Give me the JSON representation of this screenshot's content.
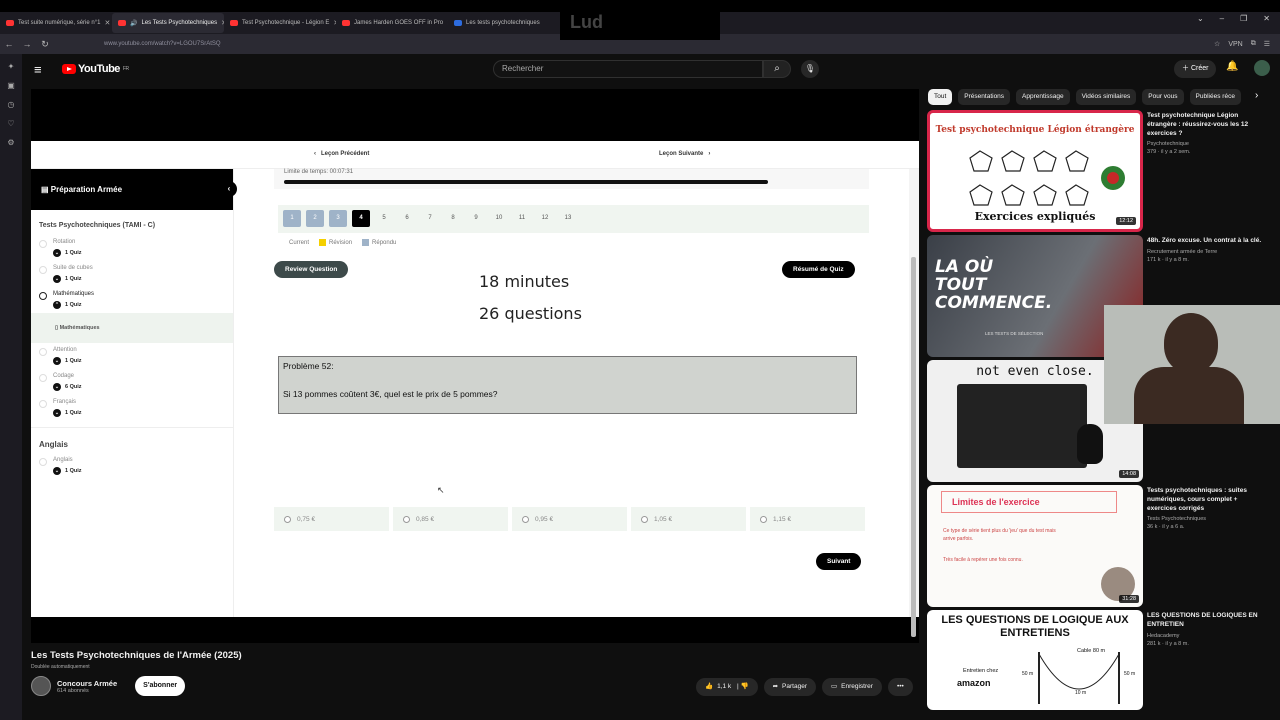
{
  "overlay_label": "Lud",
  "browser": {
    "tabs": [
      {
        "label": "Test suite numérique, série n°1",
        "color": "#ff3333"
      },
      {
        "label": "Les Tests Psychotechniques",
        "color": "#ff3333"
      },
      {
        "label": "Test Psychotechnique - Légion E",
        "color": "#ff3333"
      },
      {
        "label": "James Harden GOES OFF in Pro",
        "color": "#ff3333"
      },
      {
        "label": "Les tests psychotechniques",
        "color": "#2d6cdf"
      }
    ],
    "url": "www.youtube.com/watch?v=LGOU7SrAtSQ",
    "vpn_label": "VPN"
  },
  "youtube": {
    "logo": "YouTube",
    "logo_region": "FR",
    "search_placeholder": "Rechercher",
    "create_label": "Créer"
  },
  "course": {
    "prev_lesson": "Leçon Précédent",
    "next_lesson": "Leçon Suivante",
    "sidebar_title": "Préparation Armée",
    "section_title": "Tests Psychotechniques (TAMI - C)",
    "items": [
      {
        "name": "Rotation",
        "quiz": "1 Quiz"
      },
      {
        "name": "Suite de cubes",
        "quiz": "1 Quiz"
      },
      {
        "name": "Mathématiques",
        "quiz": "1 Quiz",
        "sub": "Mathématiques"
      },
      {
        "name": "Attention",
        "quiz": "1 Quiz"
      },
      {
        "name": "Codage",
        "quiz": "6 Quiz"
      },
      {
        "name": "Français",
        "quiz": "1 Quiz"
      }
    ],
    "section2_title": "Anglais",
    "item_anglais": {
      "name": "Anglais",
      "quiz": "1 Quiz"
    },
    "time_limit": "Limite de temps: 00:07:31",
    "time_progress_pct": 94,
    "pages": [
      "1",
      "2",
      "3",
      "4",
      "5",
      "6",
      "7",
      "8",
      "9",
      "10",
      "11",
      "12",
      "13"
    ],
    "current_page": 4,
    "legend": {
      "current": "Current",
      "revision": "Révision",
      "answered": "Répondu"
    },
    "review_btn": "Review Question",
    "summary_btn": "Résumé de Quiz",
    "big_line1": "18 minutes",
    "big_line2": "26 questions",
    "problem_title": "Problème 52:",
    "problem_text": "Si 13 pommes coûtent 3€, quel est le prix de 5 pommes?",
    "answers": [
      "0,75 €",
      "0,85 €",
      "0,95 €",
      "1,05 €",
      "1,15 €"
    ],
    "next_btn": "Suivant"
  },
  "video": {
    "title": "Les Tests Psychotechniques de l'Armée (2025)",
    "dubbed": "Doublée automatiquement",
    "channel": "Concours Armée",
    "subs": "614 abonnés",
    "subscribe": "S'abonner",
    "likes": "1,1 k",
    "share": "Partager",
    "save": "Enregistrer"
  },
  "chips": [
    "Tout",
    "Présentations",
    "Apprentissage",
    "Vidéos similaires",
    "Pour vous",
    "Publiées réce"
  ],
  "recommendations": [
    {
      "title": "Test psychotechnique Légion étrangère : réussirez-vous les 12 exercices ?",
      "channel": "Psychotechnique",
      "meta": "379 · il y a 2 sem.",
      "duration": "12:12",
      "thumb_top": "Test psychotechnique Légion étrangère",
      "thumb_bottom": "Exercices expliqués"
    },
    {
      "title": "48h. Zéro excuse. Un contrat à la clé.",
      "channel": "Recrutement armée de Terre",
      "meta": "171 k · il y a 8 m.",
      "duration": "",
      "thumb_text": "LA OÙ TOUT COMMENCE.",
      "thumb_sub": "LES TESTS DE SÉLECTION"
    },
    {
      "title": "",
      "channel": "",
      "meta": "",
      "duration": "14:08",
      "thumb_text": "not even close."
    },
    {
      "title": "Tests psychotechniques : suites numériques, cours complet + exercices corrigés",
      "channel": "Tests Psychotechniques",
      "meta": "36 k · il y a 6 a.",
      "duration": "31:28",
      "thumb_title": "Limites de l'exercice",
      "thumb_line1": "Ce type de série tient plus du 'jeu' que du test mais arrive parfois.",
      "thumb_line2": "Très facile à repérer une fois connu."
    },
    {
      "title": "LES QUESTIONS DE LOGIQUES EN ENTRETIEN",
      "channel": "Hedacademy",
      "meta": "281 k · il y a 8 m.",
      "duration": "",
      "thumb_title": "LES QUESTIONS DE LOGIQUE AUX ENTRETIENS",
      "thumb_interview": "Entretien chez",
      "thumb_brand": "amazon",
      "thumb_cable": "Cable 80 m",
      "thumb_m1": "50 m",
      "thumb_m2": "50 m",
      "thumb_m3": "10 m"
    }
  ]
}
